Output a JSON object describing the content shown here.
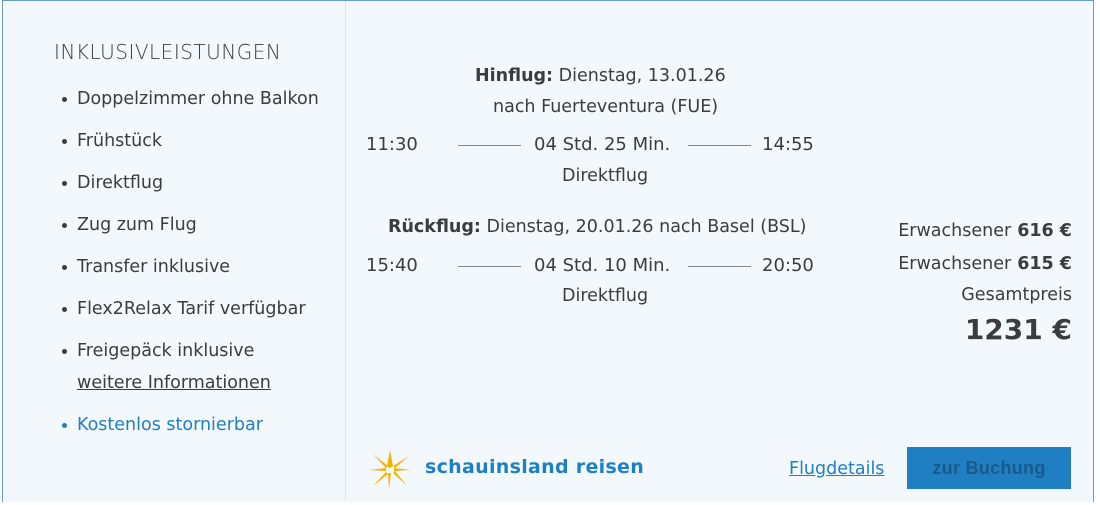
{
  "inclusions": {
    "title": "INKLUSIVLEISTUNGEN",
    "items": [
      "Doppelzimmer ohne Balkon",
      "Frühstück",
      "Direktflug",
      "Zug zum Flug",
      "Transfer inklusive",
      "Flex2Relax Tarif verfügbar",
      "Freigepäck inklusive"
    ],
    "more_info": "weitere Informationen",
    "free_cancel": "Kostenlos stornierbar"
  },
  "outbound": {
    "label": "Hinflug:",
    "date": "Dienstag, 13.01.26",
    "destination": "nach Fuerteventura (FUE)",
    "dep": "11:30",
    "duration": "04 Std. 25 Min.",
    "arr": "14:55",
    "type": "Direktflug"
  },
  "return": {
    "label": "Rückflug:",
    "date_dest": "Dienstag, 20.01.26 nach Basel (BSL)",
    "dep": "15:40",
    "duration": "04 Std. 10 Min.",
    "arr": "20:50",
    "type": "Direktflug"
  },
  "prices": {
    "rows": [
      {
        "label": "Erwachsener",
        "value": "616 €"
      },
      {
        "label": "Erwachsener",
        "value": "615 €"
      }
    ],
    "total_label": "Gesamtpreis",
    "total": "1231 €"
  },
  "footer": {
    "brand": "schauinsland reisen",
    "flight_details": "Flugdetails",
    "book": "zur Buchung"
  },
  "colors": {
    "accent": "#1f7fc2",
    "logo_yellow": "#f5b400",
    "card_bg": "#f3f8fc"
  }
}
